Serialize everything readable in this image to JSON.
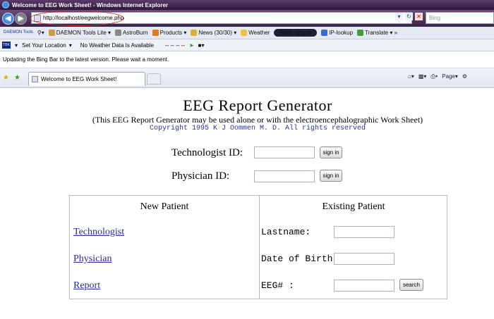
{
  "window": {
    "title": "Welcome to EEG Work Sheet! - Windows Internet Explorer"
  },
  "address": {
    "url": "http://localhost/eegwelcome.php",
    "search_placeholder": "Bing"
  },
  "toolbar": {
    "daemon_logo": "DAEMON Tools",
    "items": [
      "DAEMON Tools Lite",
      "AstroBurn",
      "Products",
      "News (30/30)",
      "Weather",
      "Radio player",
      "IP-lookup",
      "Translate"
    ]
  },
  "weather_bar": {
    "location": "Set Your Location",
    "status": "No Weather Data Is Available",
    "extras": "--   --   --  --"
  },
  "infobar": {
    "message": "Updating the Bing Bar to the latest version.  Please wait a moment."
  },
  "tab": {
    "title": "Welcome to EEG Work Sheet!"
  },
  "commandbar": {
    "page_label": "Page"
  },
  "page": {
    "title": "EEG Report Generator",
    "subtitle": "(This EEG Report Generator may be used alone or with the electroencephalographic Work Sheet)",
    "copyright": "Copyright 1995 K J Oommen M. D. All rights reserved",
    "technologist_id_label": "Technologist ID:",
    "physician_id_label": "Physician ID:",
    "sign_in_label": "sign in",
    "new_patient": {
      "heading": "New Patient",
      "links": [
        "Technologist",
        "Physician",
        "Report"
      ]
    },
    "existing_patient": {
      "heading": "Existing Patient",
      "lastname_label": "Lastname:",
      "dob_label": "Date of Birth:",
      "eeg_label": "EEG# :",
      "search_label": "search"
    }
  }
}
